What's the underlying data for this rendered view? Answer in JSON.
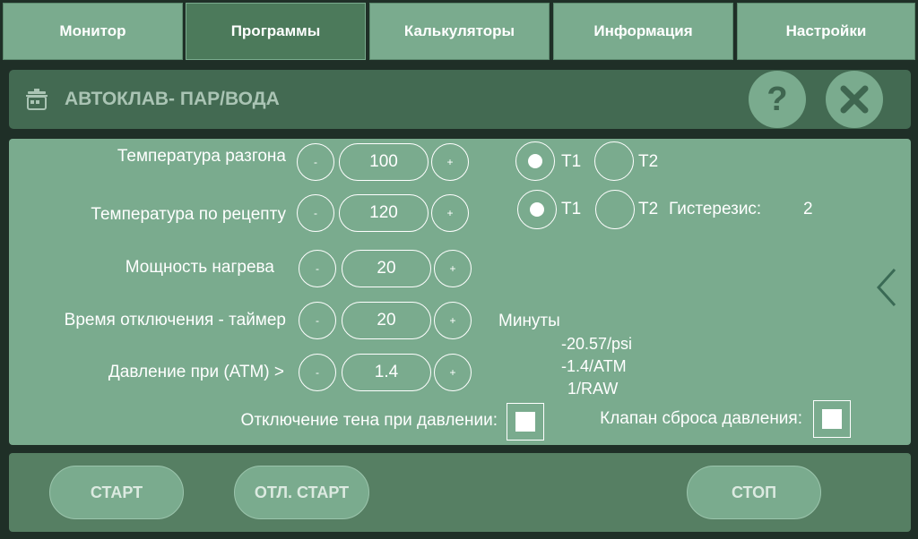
{
  "tabs": [
    {
      "label": "Монитор",
      "active": false
    },
    {
      "label": "Программы",
      "active": true
    },
    {
      "label": "Калькуляторы",
      "active": false
    },
    {
      "label": "Информация",
      "active": false
    },
    {
      "label": "Настройки",
      "active": false
    }
  ],
  "header": {
    "title": "АВТОКЛАВ- ПАР/ВОДА",
    "icon": "autoclave-pot-icon",
    "help_label": "?"
  },
  "params": [
    {
      "label": "Температура разгона",
      "minus": "-",
      "value": "100",
      "plus": "+"
    },
    {
      "label": "Температура по рецепту",
      "minus": "-",
      "value": "120",
      "plus": "+"
    },
    {
      "label": "Мощность нагрева",
      "minus": "-",
      "value": "20",
      "plus": "+"
    },
    {
      "label": "Время отключения - таймер",
      "minus": "-",
      "value": "20",
      "plus": "+"
    },
    {
      "label": "Давление при (АТМ) >",
      "minus": "-",
      "value": "1.4",
      "plus": "+"
    }
  ],
  "sensor_rows": [
    {
      "t1": "T1",
      "t2": "T2",
      "selected": "T1"
    },
    {
      "t1": "T1",
      "t2": "T2",
      "selected": "T1",
      "hysteresis_label": "Гистерезис:",
      "hysteresis_value": "2"
    }
  ],
  "timer_unit": "Минуты",
  "pressure_info": [
    "-20.57/psi",
    "-1.4/ATM",
    "1/RAW"
  ],
  "checkboxes": {
    "heater_off_label": "Отключение тена при давлении:",
    "heater_off_checked": true,
    "valve_label": "Клапан сброса давления:",
    "valve_checked": true
  },
  "footer": {
    "start": "СТАРТ",
    "delayed_start": "ОТЛ. СТАРТ",
    "stop": "СТОП"
  },
  "colors": {
    "background": "#1f2f27",
    "tab": "#7aab8e",
    "tab_active": "#4c7a5b",
    "header": "#436a52",
    "panel": "#7aab8e",
    "footer": "#567f63"
  }
}
